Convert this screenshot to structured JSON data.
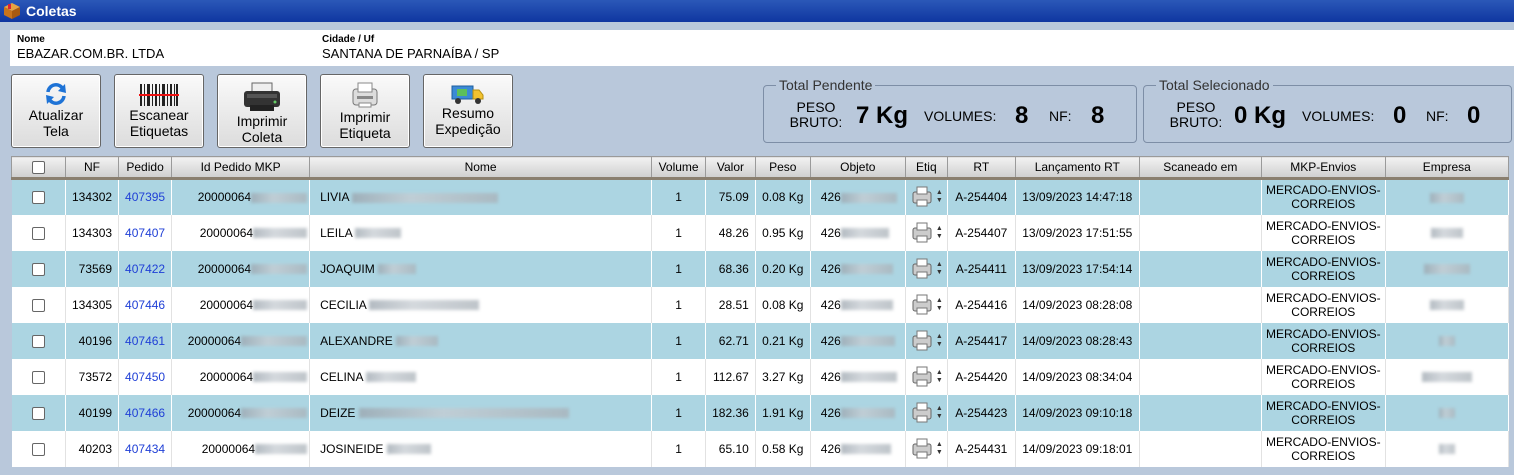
{
  "window": {
    "title": "Coletas",
    "icon": "box-icon"
  },
  "info": {
    "nome_label": "Nome",
    "nome_value": "EBAZAR.COM.BR. LTDA",
    "cidade_label": "Cidade / Uf",
    "cidade_value": "SANTANA DE PARNAÍBA / SP"
  },
  "toolbar": {
    "atualizar": [
      "Atualizar",
      "Tela"
    ],
    "escanear": [
      "Escanear",
      "Etiquetas"
    ],
    "imprimir_coleta": [
      "Imprimir",
      "Coleta"
    ],
    "imprimir_etiqueta": [
      "Imprimir",
      "Etiqueta"
    ],
    "resumo": [
      "Resumo",
      "Expedição"
    ]
  },
  "total_pendente": {
    "legend": "Total Pendente",
    "peso_label": [
      "PESO",
      "BRUTO:"
    ],
    "peso": "7 Kg",
    "volumes_label": "VOLUMES:",
    "volumes": "8",
    "nf_label": "NF:",
    "nf": "8"
  },
  "total_selecionado": {
    "legend": "Total Selecionado",
    "peso_label": [
      "PESO",
      "BRUTO:"
    ],
    "peso": "0 Kg",
    "volumes_label": "VOLUMES:",
    "volumes": "0",
    "nf_label": "NF:",
    "nf": "0"
  },
  "table": {
    "headers": [
      "",
      "NF",
      "Pedido",
      "Id Pedido MKP",
      "Nome",
      "Volume",
      "Valor",
      "Peso",
      "Objeto",
      "Etiq",
      "RT",
      "Lançamento RT",
      "Scaneado em",
      "MKP-Envios",
      "Empresa"
    ],
    "rows": [
      {
        "nf": "134302",
        "pedido": "407395",
        "id_mkp": "20000064",
        "nome": "LIVIA",
        "volume": "1",
        "valor": "75.09",
        "peso": "0.08 Kg",
        "objeto": "426",
        "rt": "A-254404",
        "lancamento": "13/09/2023 14:47:18",
        "scaneado": "",
        "mkp": [
          "MERCADO-ENVIOS-",
          "CORREIOS"
        ]
      },
      {
        "nf": "134303",
        "pedido": "407407",
        "id_mkp": "20000064",
        "nome": "LEILA",
        "volume": "1",
        "valor": "48.26",
        "peso": "0.95 Kg",
        "objeto": "426",
        "rt": "A-254407",
        "lancamento": "13/09/2023 17:51:55",
        "scaneado": "",
        "mkp": [
          "MERCADO-ENVIOS-",
          "CORREIOS"
        ]
      },
      {
        "nf": "73569",
        "pedido": "407422",
        "id_mkp": "20000064",
        "nome": "JOAQUIM",
        "volume": "1",
        "valor": "68.36",
        "peso": "0.20 Kg",
        "objeto": "426",
        "rt": "A-254411",
        "lancamento": "13/09/2023 17:54:14",
        "scaneado": "",
        "mkp": [
          "MERCADO-ENVIOS-",
          "CORREIOS"
        ]
      },
      {
        "nf": "134305",
        "pedido": "407446",
        "id_mkp": "20000064",
        "nome": "CECILIA",
        "volume": "1",
        "valor": "28.51",
        "peso": "0.08 Kg",
        "objeto": "426",
        "rt": "A-254416",
        "lancamento": "14/09/2023 08:28:08",
        "scaneado": "",
        "mkp": [
          "MERCADO-ENVIOS-",
          "CORREIOS"
        ]
      },
      {
        "nf": "40196",
        "pedido": "407461",
        "id_mkp": "20000064",
        "nome": "ALEXANDRE",
        "volume": "1",
        "valor": "62.71",
        "peso": "0.21 Kg",
        "objeto": "426",
        "rt": "A-254417",
        "lancamento": "14/09/2023 08:28:43",
        "scaneado": "",
        "mkp": [
          "MERCADO-ENVIOS-",
          "CORREIOS"
        ]
      },
      {
        "nf": "73572",
        "pedido": "407450",
        "id_mkp": "20000064",
        "nome": "CELINA",
        "volume": "1",
        "valor": "112.67",
        "peso": "3.27 Kg",
        "objeto": "426",
        "rt": "A-254420",
        "lancamento": "14/09/2023 08:34:04",
        "scaneado": "",
        "mkp": [
          "MERCADO-ENVIOS-",
          "CORREIOS"
        ]
      },
      {
        "nf": "40199",
        "pedido": "407466",
        "id_mkp": "20000064",
        "nome": "DEIZE",
        "volume": "1",
        "valor": "182.36",
        "peso": "1.91 Kg",
        "objeto": "426",
        "rt": "A-254423",
        "lancamento": "14/09/2023 09:10:18",
        "scaneado": "",
        "mkp": [
          "MERCADO-ENVIOS-",
          "CORREIOS"
        ]
      },
      {
        "nf": "40203",
        "pedido": "407434",
        "id_mkp": "20000064",
        "nome": "JOSINEIDE",
        "volume": "1",
        "valor": "65.10",
        "peso": "0.58 Kg",
        "objeto": "426",
        "rt": "A-254431",
        "lancamento": "14/09/2023 09:18:01",
        "scaneado": "",
        "mkp": [
          "MERCADO-ENVIOS-",
          "CORREIOS"
        ]
      }
    ]
  }
}
